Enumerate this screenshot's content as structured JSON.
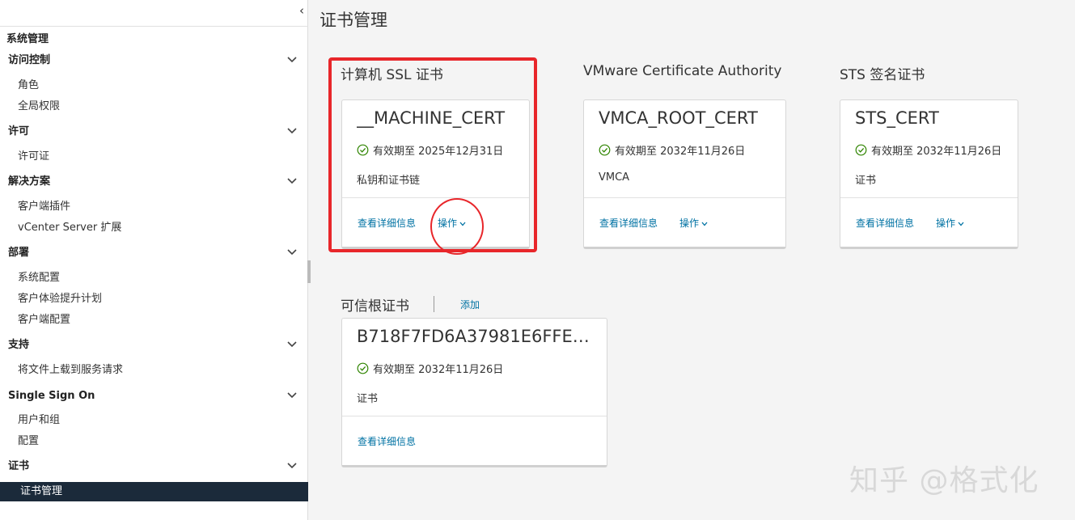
{
  "sidebar": {
    "collapse_icon": "chevron-left-icon",
    "title": "系统管理",
    "sections": [
      {
        "label": "访问控制",
        "items": [
          "角色",
          "全局权限"
        ]
      },
      {
        "label": "许可",
        "items": [
          "许可证"
        ]
      },
      {
        "label": "解决方案",
        "items": [
          "客户端插件",
          "vCenter Server 扩展"
        ]
      },
      {
        "label": "部署",
        "items": [
          "系统配置",
          "客户体验提升计划",
          "客户端配置"
        ]
      },
      {
        "label": "支持",
        "items": [
          "将文件上载到服务请求"
        ]
      },
      {
        "label": "Single Sign On",
        "items": [
          "用户和组",
          "配置"
        ]
      },
      {
        "label": "证书",
        "items": [
          "证书管理"
        ]
      }
    ],
    "active_item": "证书管理"
  },
  "main": {
    "title": "证书管理",
    "groups": [
      {
        "title": "计算机 SSL 证书",
        "card": {
          "name": "__MACHINE_CERT",
          "valid": "有效期至 2025年12月31日",
          "desc": "私钥和证书链",
          "details": "查看详细信息",
          "action": "操作"
        }
      },
      {
        "title": "VMware Certificate Authority",
        "card": {
          "name": "VMCA_ROOT_CERT",
          "valid": "有效期至 2032年11月26日",
          "desc": "VMCA",
          "details": "查看详细信息",
          "action": "操作"
        }
      },
      {
        "title": "STS 签名证书",
        "card": {
          "name": "STS_CERT",
          "valid": "有效期至 2032年11月26日",
          "desc": "证书",
          "details": "查看详细信息",
          "action": "操作"
        }
      },
      {
        "title": "可信根证书",
        "add_label": "添加",
        "card": {
          "name": "B718F7FD6A37981E6FFEC...",
          "valid": "有效期至 2032年11月26日",
          "desc": "证书",
          "details": "查看详细信息"
        }
      }
    ]
  },
  "colors": {
    "link": "#0072a3",
    "active_bg": "#1b2a3a",
    "valid_green": "#2f8400",
    "annotation": "#e8262a"
  },
  "watermark": "知乎 @格式化"
}
